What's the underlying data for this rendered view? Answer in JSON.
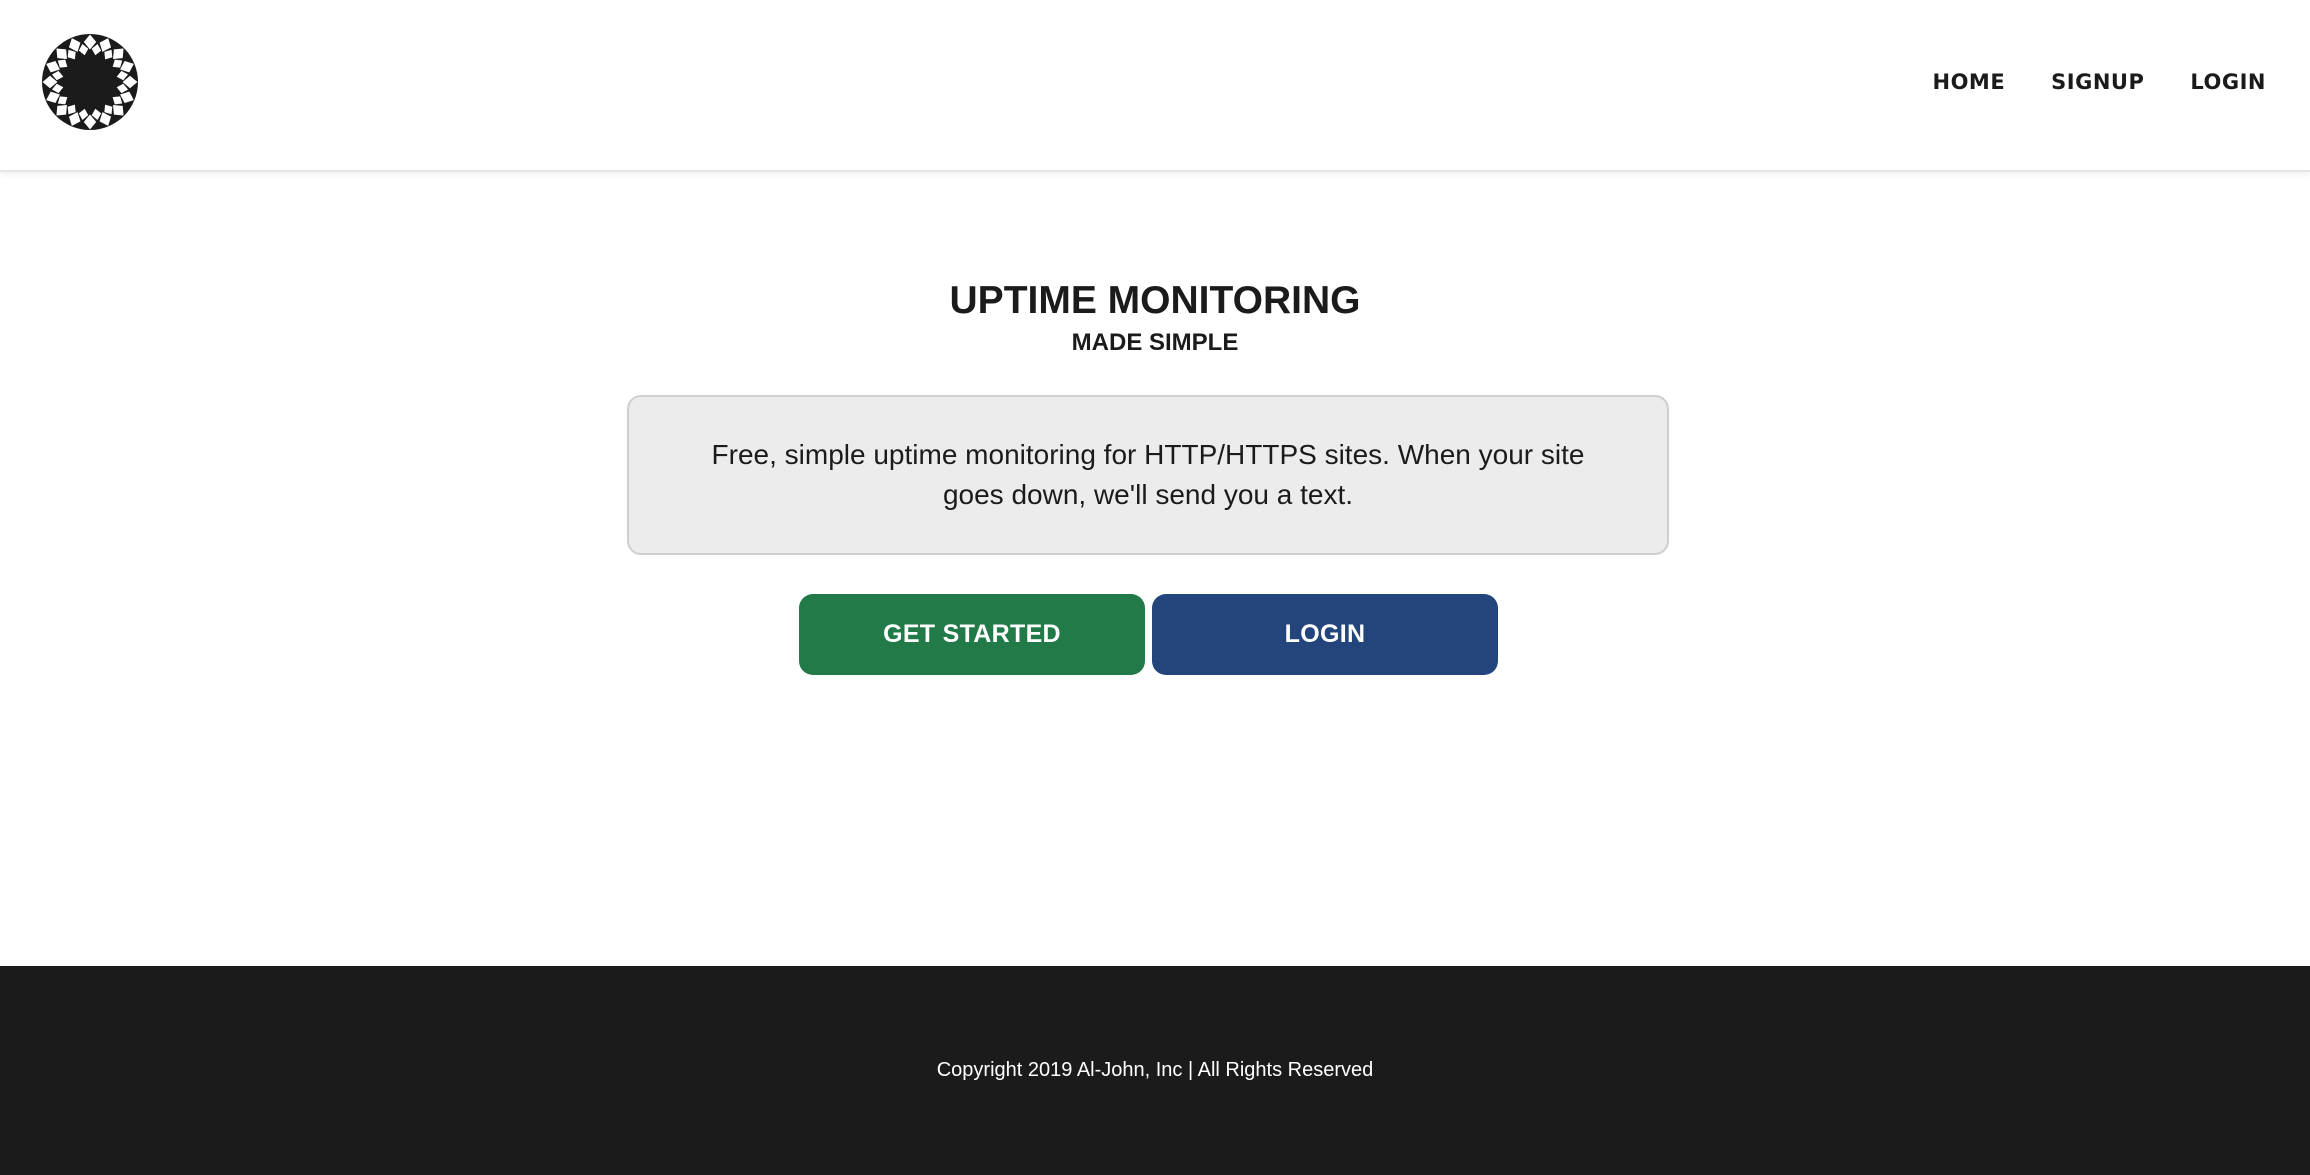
{
  "header": {
    "logo_icon": "circular-checkered-logo-icon",
    "nav": [
      {
        "label": "HOME"
      },
      {
        "label": "SIGNUP"
      },
      {
        "label": "LOGIN"
      }
    ]
  },
  "hero": {
    "title": "UPTIME MONITORING",
    "subtitle": "MADE SIMPLE",
    "description": "Free, simple uptime monitoring for HTTP/HTTPS sites. When your site goes down, we'll send you a text.",
    "get_started_label": "GET STARTED",
    "login_label": "LOGIN"
  },
  "footer": {
    "copyright": "Copyright 2019 Al-John, Inc | All Rights Reserved"
  },
  "colors": {
    "get_started_bg": "#217a48",
    "login_bg": "#23457b",
    "footer_bg": "#1b1b1b",
    "desc_box_bg": "#ececec"
  }
}
